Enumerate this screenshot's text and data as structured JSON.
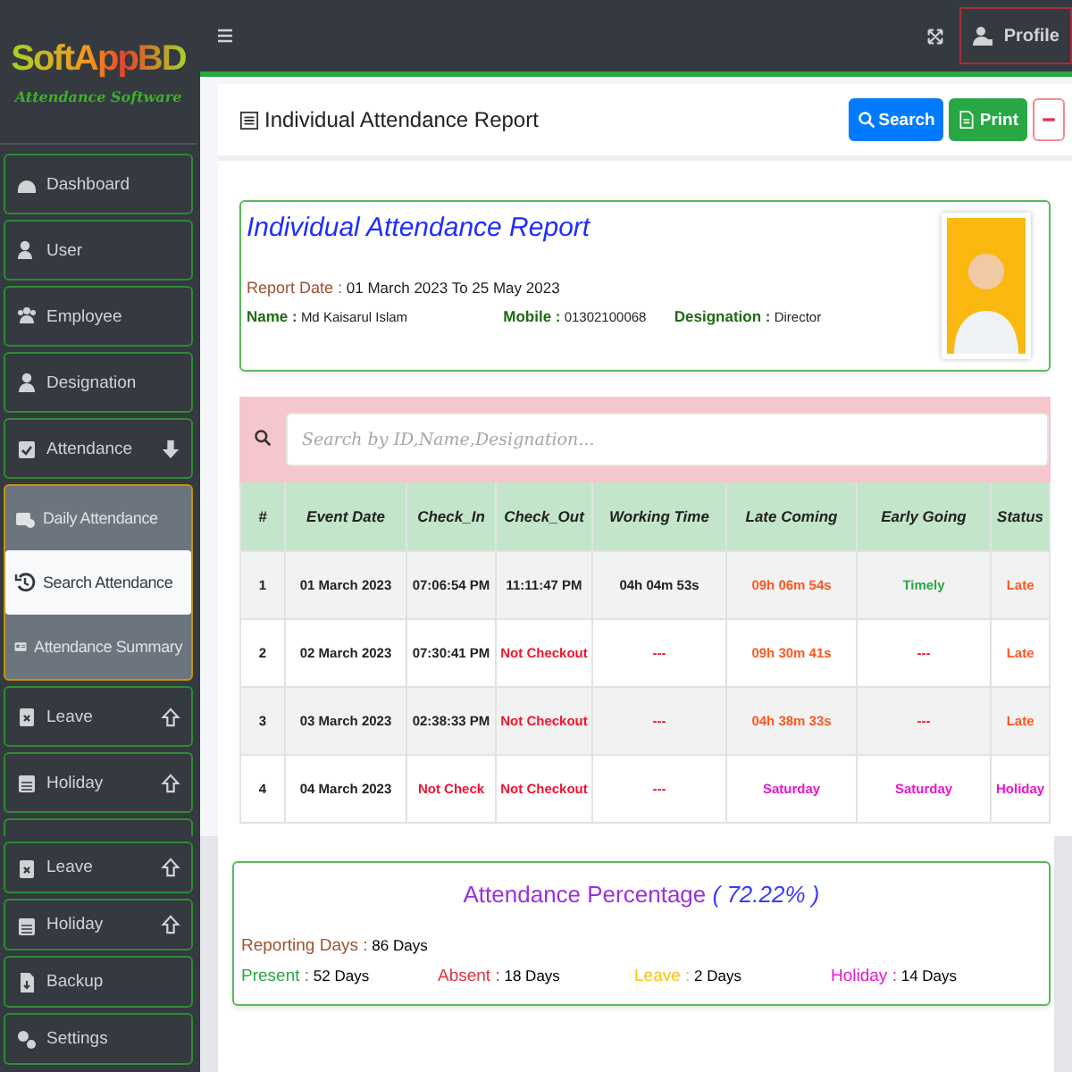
{
  "brand": {
    "logo": "SoftAppBD",
    "tagline": "Attendance Software"
  },
  "topbar": {
    "profile": "Profile"
  },
  "sidebar": {
    "items": [
      {
        "label": "Dashboard",
        "kind": "link"
      },
      {
        "label": "User",
        "kind": "link"
      },
      {
        "label": "Employee",
        "kind": "link"
      },
      {
        "label": "Designation",
        "kind": "link"
      },
      {
        "label": "Attendance",
        "kind": "menu",
        "expanded": true,
        "children": [
          {
            "label": "Daily Attendance",
            "selected": false
          },
          {
            "label": "Search Attendance",
            "selected": true
          },
          {
            "label": "Attendance Summary",
            "selected": false
          }
        ]
      },
      {
        "label": "Leave",
        "kind": "menu",
        "expanded": false
      },
      {
        "label": "Holiday",
        "kind": "menu",
        "expanded": false
      }
    ]
  },
  "report": {
    "title": "Individual Attendance Report",
    "buttons": [
      {
        "label": "Search",
        "kind": "primary"
      },
      {
        "label": "Print",
        "kind": "success"
      },
      {
        "kind": "collapse"
      }
    ]
  },
  "info": {
    "heading": "Individual Attendance Report",
    "report_date": {
      "label": "Report Date :",
      "value": "01 March 2023 To 25 May 2023"
    },
    "fields": [
      {
        "label": "Name :",
        "value": "Md Kaisarul Islam"
      },
      {
        "label": "Mobile :",
        "value": "01302100068"
      },
      {
        "label": "Designation :",
        "value": "Director"
      }
    ]
  },
  "table": {
    "search_placeholder": "Search by ID,Name,Designation...",
    "columns": [
      "#",
      "Event Date",
      "Check_In",
      "Check_Out",
      "Working Time",
      "Late Coming",
      "Early Going",
      "Status"
    ],
    "rows": [
      {
        "cells": [
          {
            "text": "1"
          },
          {
            "text": "01 March 2023"
          },
          {
            "text": "07:06:54 PM"
          },
          {
            "text": "11:11:47 PM"
          },
          {
            "text": "04h 04m 53s"
          },
          {
            "text": "09h 06m 54s",
            "color": "#ff5722"
          },
          {
            "text": "Timely",
            "color": "#28a745"
          },
          {
            "text": "Late",
            "color": "#ff5722"
          }
        ]
      },
      {
        "cells": [
          {
            "text": "2"
          },
          {
            "text": "02 March 2023"
          },
          {
            "text": "07:30:41 PM"
          },
          {
            "text": "Not Checkout",
            "color": "#f0142f"
          },
          {
            "text": "---",
            "color": "#f0142f"
          },
          {
            "text": "09h 30m 41s",
            "color": "#ff5722"
          },
          {
            "text": "---",
            "color": "#f0142f"
          },
          {
            "text": "Late",
            "color": "#ff5722"
          }
        ]
      },
      {
        "cells": [
          {
            "text": "3"
          },
          {
            "text": "03 March 2023"
          },
          {
            "text": "02:38:33 PM"
          },
          {
            "text": "Not Checkout",
            "color": "#f0142f"
          },
          {
            "text": "---",
            "color": "#f0142f"
          },
          {
            "text": "04h 38m 33s",
            "color": "#ff5722"
          },
          {
            "text": "---",
            "color": "#f0142f"
          },
          {
            "text": "Late",
            "color": "#ff5722"
          }
        ]
      },
      {
        "cells": [
          {
            "text": "4"
          },
          {
            "text": "04 March 2023"
          },
          {
            "text": "Not Check",
            "color": "#f0142f"
          },
          {
            "text": "Not Checkout",
            "color": "#f0142f"
          },
          {
            "text": "---",
            "color": "#f0142f"
          },
          {
            "text": "Saturday",
            "color": "#e815d0"
          },
          {
            "text": "Saturday",
            "color": "#e815d0"
          },
          {
            "text": "Holiday",
            "color": "#e815d0"
          }
        ]
      }
    ]
  },
  "lower_sidebar": {
    "items": [
      {
        "label": "Leave",
        "kind": "menu",
        "expanded": false
      },
      {
        "label": "Holiday",
        "kind": "menu",
        "expanded": false
      },
      {
        "label": "Backup",
        "kind": "link"
      },
      {
        "label": "Settings",
        "kind": "link"
      }
    ]
  },
  "summary": {
    "title": "Attendance Percentage",
    "percentage": "( 72.22% )",
    "reporting": {
      "label": "Reporting Days :",
      "value": "86 Days"
    },
    "stats": [
      {
        "label": "Present :",
        "value": "52 Days",
        "color": "#28a745"
      },
      {
        "label": "Absent :",
        "value": "18 Days",
        "color": "#dc3545"
      },
      {
        "label": "Leave :",
        "value": "2 Days",
        "color": "#ffc107"
      },
      {
        "label": "Holiday :",
        "value": "14 Days",
        "color": "#e815d0"
      }
    ]
  }
}
